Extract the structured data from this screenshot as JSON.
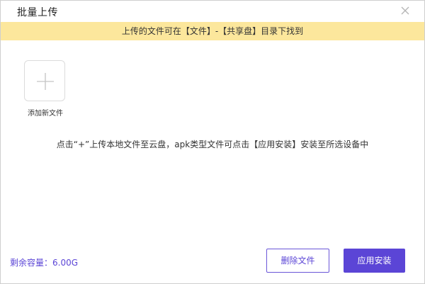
{
  "window": {
    "title": "批量上传",
    "close_icon": "close-icon"
  },
  "banner": {
    "text": "上传的文件可在【文件】-【共享盘】目录下找到",
    "color": "#fce79c"
  },
  "upload": {
    "add_icon": "plus-icon",
    "add_label": "添加新文件"
  },
  "hint": "点击“+”上传本地文件至云盘，apk类型文件可点击【应用安装】安装至所选设备中",
  "footer": {
    "capacity": "剩余容量：6.00G",
    "delete_label": "删除文件",
    "install_label": "应用安装",
    "accent_color": "#5b45d6"
  }
}
